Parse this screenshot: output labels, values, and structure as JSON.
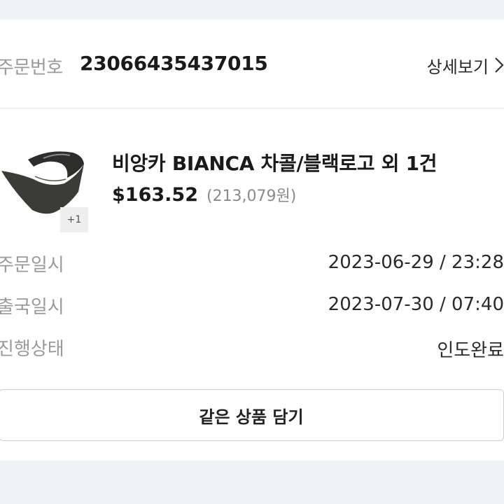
{
  "order": {
    "label": "주문번호",
    "number": "23066435437015",
    "detail_link": "상세보기"
  },
  "product": {
    "name": "비앙카 BIANCA 차콜/블랙로고 외 1건",
    "price_usd": "$163.52",
    "price_krw": "(213,079원)",
    "extra_count": "+1",
    "thumbnail_icon": "visor-hat-icon"
  },
  "info": [
    {
      "label": "주문일시",
      "value": "2023-06-29 / 23:28"
    },
    {
      "label": "출국일시",
      "value": "2023-07-30 / 07:40"
    },
    {
      "label": "진행상태",
      "value": "인도완료"
    }
  ],
  "actions": {
    "add_same_label": "같은 상품 담기"
  }
}
